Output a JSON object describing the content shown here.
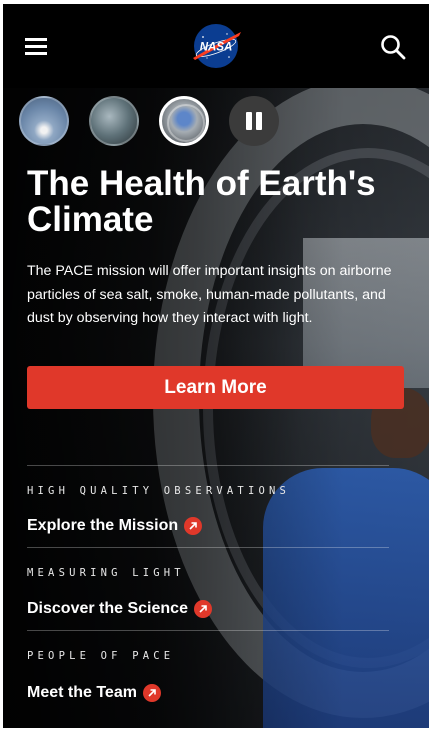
{
  "header": {
    "menu_icon": "hamburger-menu-icon",
    "logo_text": "NASA",
    "search_icon": "search-icon"
  },
  "carousel": {
    "thumbnails": [
      "rocket-launch",
      "earth-closeup",
      "pace-technician"
    ],
    "active_index": 2,
    "pause_icon": "pause-icon"
  },
  "hero": {
    "title": "The Health of Earth's Climate",
    "description": "The PACE mission will offer important insights on airborne particles of sea salt, smoke, human-made pollutants, and dust by observing how they interact with light.",
    "cta_label": "Learn More"
  },
  "sections": [
    {
      "kicker": "HIGH QUALITY OBSERVATIONS",
      "link": "Explore the Mission"
    },
    {
      "kicker": "MEASURING LIGHT",
      "link": "Discover the Science"
    },
    {
      "kicker": "PEOPLE OF PACE",
      "link": "Meet the Team"
    }
  ],
  "colors": {
    "accent": "#e0382a",
    "header_bg": "#000000",
    "nasa_blue": "#0b3d91",
    "nasa_red": "#fc3d21"
  }
}
